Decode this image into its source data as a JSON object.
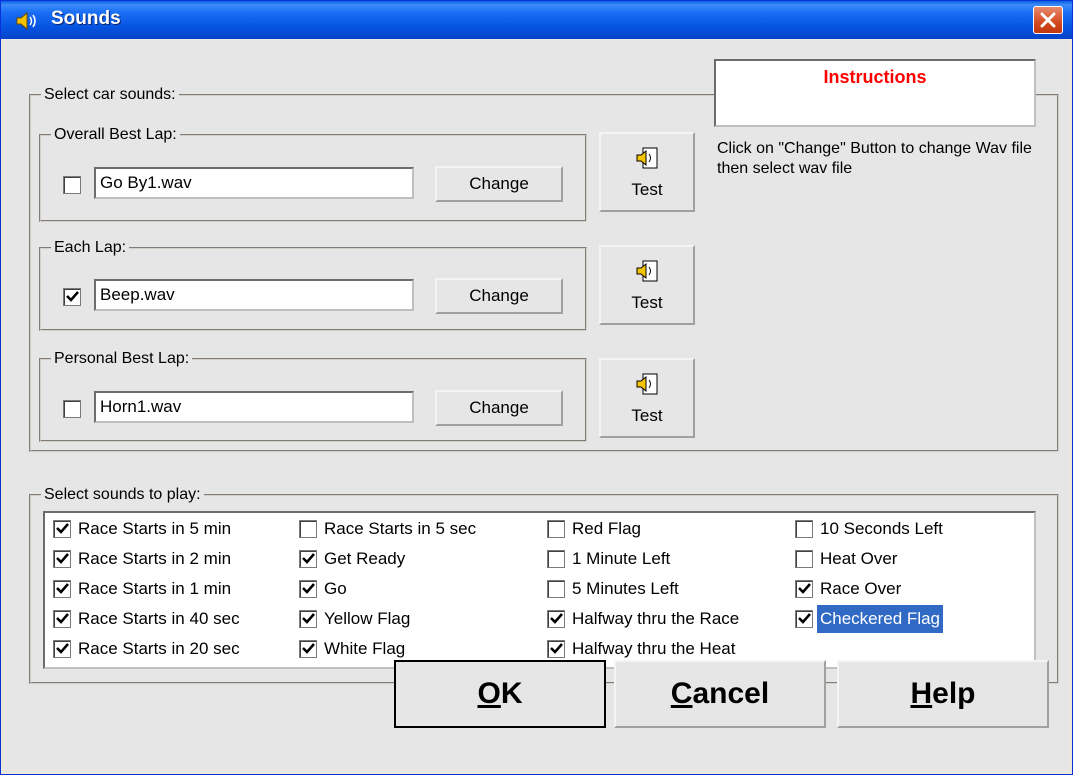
{
  "window": {
    "title": "Sounds",
    "close_label": "✕"
  },
  "car_sounds": {
    "group_label": "Select car sounds:",
    "rows": [
      {
        "label": "Overall Best Lap:",
        "checked": false,
        "file": "Go By1.wav",
        "change_label": "Change",
        "test_label": "Test"
      },
      {
        "label": "Each Lap:",
        "checked": true,
        "file": "Beep.wav",
        "change_label": "Change",
        "test_label": "Test"
      },
      {
        "label": "Personal Best Lap:",
        "checked": false,
        "file": "Horn1.wav",
        "change_label": "Change",
        "test_label": "Test"
      }
    ]
  },
  "instructions": {
    "title": "Instructions",
    "text": "Click on \"Change\" Button to change Wav file then select wav file"
  },
  "play_sounds": {
    "group_label": "Select sounds  to play:",
    "columns": [
      [
        {
          "label": "Race Starts in 5 min",
          "checked": true
        },
        {
          "label": "Race Starts in 2 min",
          "checked": true
        },
        {
          "label": "Race Starts in 1 min",
          "checked": true
        },
        {
          "label": "Race Starts in 40 sec",
          "checked": true
        },
        {
          "label": "Race Starts in 20 sec",
          "checked": true
        }
      ],
      [
        {
          "label": "Race Starts in 5 sec",
          "checked": false
        },
        {
          "label": "Get Ready",
          "checked": true
        },
        {
          "label": "Go",
          "checked": true
        },
        {
          "label": "Yellow Flag",
          "checked": true
        },
        {
          "label": "White Flag",
          "checked": true
        }
      ],
      [
        {
          "label": "Red Flag",
          "checked": false
        },
        {
          "label": "1 Minute Left",
          "checked": false
        },
        {
          "label": "5 Minutes Left",
          "checked": false
        },
        {
          "label": "Halfway thru the Race",
          "checked": true
        },
        {
          "label": "Halfway thru the Heat",
          "checked": true
        }
      ],
      [
        {
          "label": "10 Seconds Left",
          "checked": false
        },
        {
          "label": "Heat Over",
          "checked": false
        },
        {
          "label": "Race Over",
          "checked": true
        },
        {
          "label": "Checkered Flag",
          "checked": true,
          "selected": true
        }
      ]
    ]
  },
  "buttons": {
    "ok": {
      "accel": "O",
      "rest": "K"
    },
    "cancel": {
      "accel": "C",
      "rest": "ancel"
    },
    "help": {
      "accel": "H",
      "rest": "elp"
    }
  },
  "colors": {
    "title_bar": "#0553e0",
    "instructions_title": "#ff0000",
    "selection": "#316ac5"
  }
}
